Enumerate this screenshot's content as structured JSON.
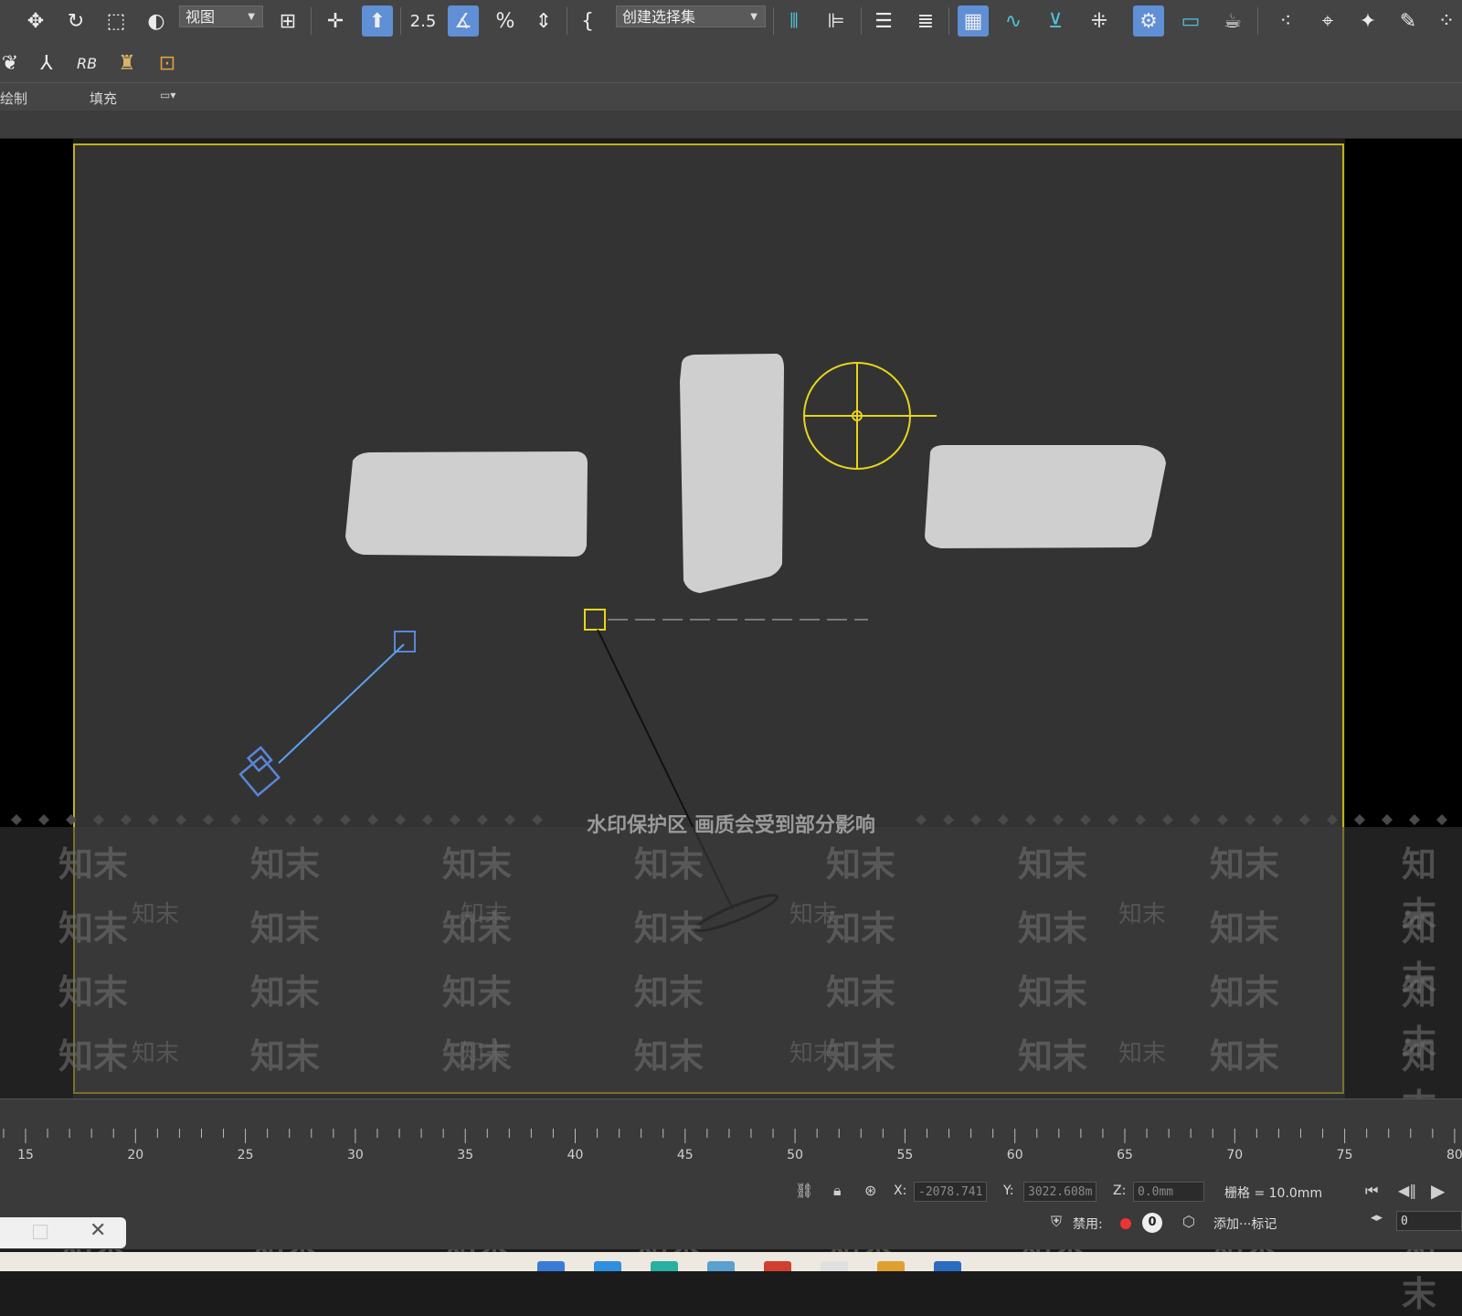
{
  "toolbar": {
    "view_dropdown": "视图",
    "selection_set_dropdown": "创建选择集",
    "snap_25_label": "2.5",
    "percent_snap": "%"
  },
  "toolbar2": {
    "rb_label": "RB"
  },
  "ribbon": {
    "tab_draw": "绘制",
    "tab_fill": "填充"
  },
  "watermark": {
    "banner": "水印保护区  画质会受到部分影响",
    "text": "知末"
  },
  "timeline": {
    "ticks": [
      "15",
      "20",
      "25",
      "30",
      "35",
      "40",
      "45",
      "50",
      "55",
      "60",
      "65",
      "70",
      "75",
      "80"
    ]
  },
  "status": {
    "x_label": "X:",
    "x_value": "-2078.741",
    "y_label": "Y:",
    "y_value": "3022.608m",
    "z_label": "Z:",
    "z_value": "0.0mm",
    "grid": "栅格 = 10.0mm",
    "disable_label": "禁用:",
    "zero_badge": "0",
    "add_tag": "添加···标记",
    "frame_value": "0"
  },
  "colors": {
    "viewport_border": "#c0b21a",
    "light_gizmo": "#e6d51c",
    "camera_blue": "#5a86d8",
    "object_gray": "#cfcfcf"
  }
}
